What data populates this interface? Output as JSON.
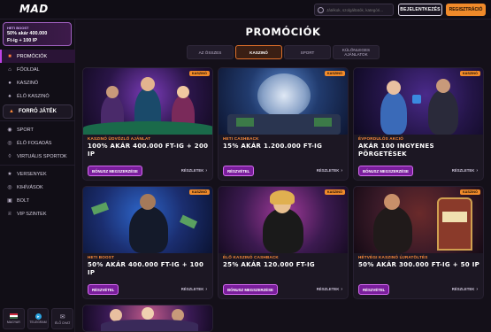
{
  "header": {
    "logo": "MAD",
    "search_placeholder": "Játékok, szolgáltatók, kategóri...",
    "login_label": "BEJELENTKEZÉS",
    "register_label": "REGISZTRÁCIÓ"
  },
  "sidebar": {
    "boost": {
      "tag": "HETI BOOST",
      "line1": "50% akár 400.000",
      "line2": "Ft-ig + 100 IP"
    },
    "items": [
      {
        "label": "PROMÓCIÓK",
        "icon": "gift-icon"
      },
      {
        "label": "FŐOLDAL",
        "icon": "home-icon"
      },
      {
        "label": "KASZINÓ",
        "icon": "cherry-icon"
      },
      {
        "label": "ÉLŐ KASZINÓ",
        "icon": "cards-icon"
      },
      {
        "label": "FORRÓ JÁTÉK",
        "icon": "flame-icon"
      },
      {
        "label": "SPORT",
        "icon": "ball-icon"
      },
      {
        "label": "ÉLŐ FOGADÁS",
        "icon": "live-icon"
      },
      {
        "label": "VIRTUÁLIS SPORTOK",
        "icon": "virtual-icon"
      },
      {
        "label": "VERSENYEK",
        "icon": "trophy-icon"
      },
      {
        "label": "KIHÍVÁSOK",
        "icon": "target-icon"
      },
      {
        "label": "BOLT",
        "icon": "shop-icon"
      },
      {
        "label": "VIP SZINTEK",
        "icon": "crown-icon"
      }
    ],
    "bottom": {
      "language": "MAGYAR",
      "telegram": "TELEGRAM",
      "chat": "ÉLŐ CHAT"
    }
  },
  "main": {
    "title": "PROMÓCIÓK",
    "tabs": [
      "AZ ÖSSZES",
      "KASZINÓ",
      "SPORT",
      "KÜLÖNLEGES AJÁNLATOK"
    ],
    "active_tab": "KASZINÓ",
    "cards": [
      {
        "badge": "KASZINÓ",
        "kicker": "KASZINÓ ÜDVÖZLŐ AJÁNLAT",
        "title": "100% AKÁR 400.000 FT-IG + 200 IP",
        "cta": "BÓNUSZ MEGSZERZÉSE",
        "more": "RÉSZLETEK"
      },
      {
        "badge": "KASZINÓ",
        "kicker": "HETI CASHBACK",
        "title": "15% AKÁR 1.200.000 FT-IG",
        "cta": "RÉSZVÉTEL",
        "more": "RÉSZLETEK"
      },
      {
        "badge": "KASZINÓ",
        "kicker": "ÉVFORDULÓS AKCIÓ",
        "title": "AKÁR 100 INGYENES PÖRGETÉSEK",
        "cta": "BÓNUSZ MEGSZERZÉSE",
        "more": "RÉSZLETEK"
      },
      {
        "badge": "KASZINÓ",
        "kicker": "HETI BOOST",
        "title": "50% AKÁR 400.000 FT-IG + 100 IP",
        "cta": "RÉSZVÉTEL",
        "more": "RÉSZLETEK"
      },
      {
        "badge": "KASZINÓ",
        "kicker": "ÉLŐ KASZINÓ CASHBACK",
        "title": "25% AKÁR 120.000 FT-IG",
        "cta": "BÓNUSZ MEGSZERZÉSE",
        "more": "RÉSZLETEK"
      },
      {
        "badge": "KASZINÓ",
        "kicker": "HÉTVÉGI KASZINÓ ÚJRATÖLTÉS",
        "title": "50% AKÁR 300.000 FT-IG + 50 IP",
        "cta": "RÉSZVÉTEL",
        "more": "RÉSZLETEK"
      }
    ]
  },
  "colors": {
    "accent": "#f08a2a",
    "purple": "#7a1e9c",
    "bg": "#141019"
  }
}
